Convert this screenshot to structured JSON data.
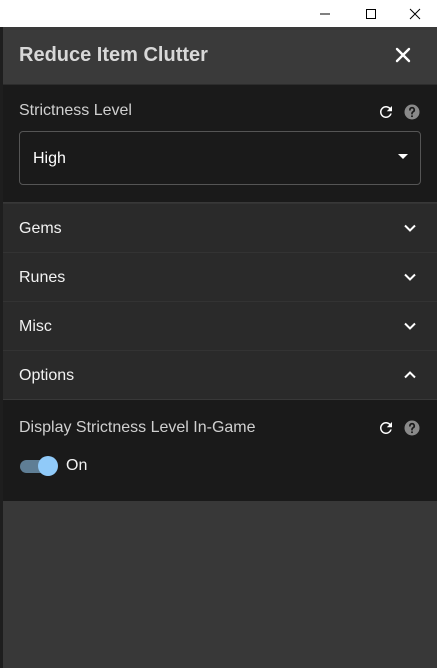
{
  "window": {
    "minimize_icon": "minimize-icon",
    "maximize_icon": "maximize-icon",
    "close_icon": "close-icon"
  },
  "panel": {
    "title": "Reduce Item Clutter",
    "close_icon": "close-icon"
  },
  "strictness": {
    "label": "Strictness Level",
    "reset_icon": "refresh-icon",
    "help_icon": "help-icon",
    "selected": "High"
  },
  "accordions": [
    {
      "label": "Gems",
      "expanded": false
    },
    {
      "label": "Runes",
      "expanded": false
    },
    {
      "label": "Misc",
      "expanded": false
    },
    {
      "label": "Options",
      "expanded": true
    }
  ],
  "options": {
    "display_label": "Display Strictness Level In-Game",
    "toggle_state": "On",
    "toggle_on": true
  },
  "colors": {
    "accent": "#90caf9",
    "panel_bg": "#383838",
    "section_bg": "#1a1a1a"
  }
}
